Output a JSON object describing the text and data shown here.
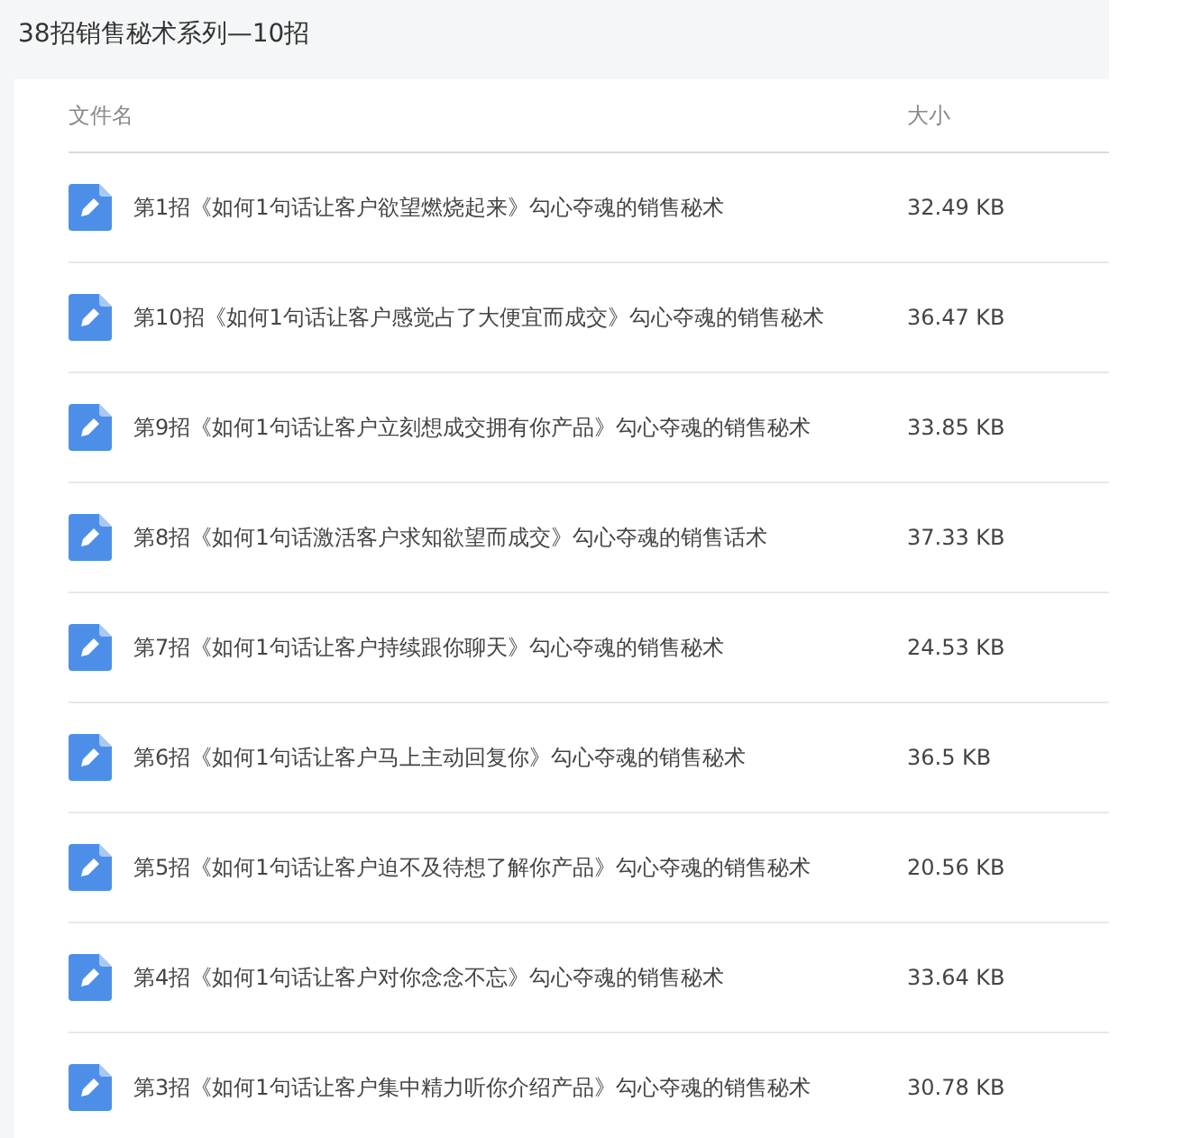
{
  "title": "38招销售秘术系列—10招",
  "table": {
    "columns": [
      "文件名",
      "大小"
    ],
    "rows": [
      {
        "name": "第1招《如何1句话让客户欲望燃烧起来》勾心夺魂的销售秘术",
        "size": "32.49 KB"
      },
      {
        "name": "第10招《如何1句话让客户感觉占了大便宜而成交》勾心夺魂的销售秘术",
        "size": "36.47 KB"
      },
      {
        "name": "第9招《如何1句话让客户立刻想成交拥有你产品》勾心夺魂的销售秘术",
        "size": "33.85 KB"
      },
      {
        "name": "第8招《如何1句话激活客户求知欲望而成交》勾心夺魂的销售话术",
        "size": "37.33 KB"
      },
      {
        "name": "第7招《如何1句话让客户持续跟你聊天》勾心夺魂的销售秘术",
        "size": "24.53 KB"
      },
      {
        "name": "第6招《如何1句话让客户马上主动回复你》勾心夺魂的销售秘术",
        "size": "36.5 KB"
      },
      {
        "name": "第5招《如何1句话让客户迫不及待想了解你产品》勾心夺魂的销售秘术",
        "size": "20.56 KB"
      },
      {
        "name": "第4招《如何1句话让客户对你念念不忘》勾心夺魂的销售秘术",
        "size": "33.64 KB"
      },
      {
        "name": "第3招《如何1句话让客户集中精力听你介绍产品》勾心夺魂的销售秘术",
        "size": "30.78 KB"
      }
    ]
  }
}
